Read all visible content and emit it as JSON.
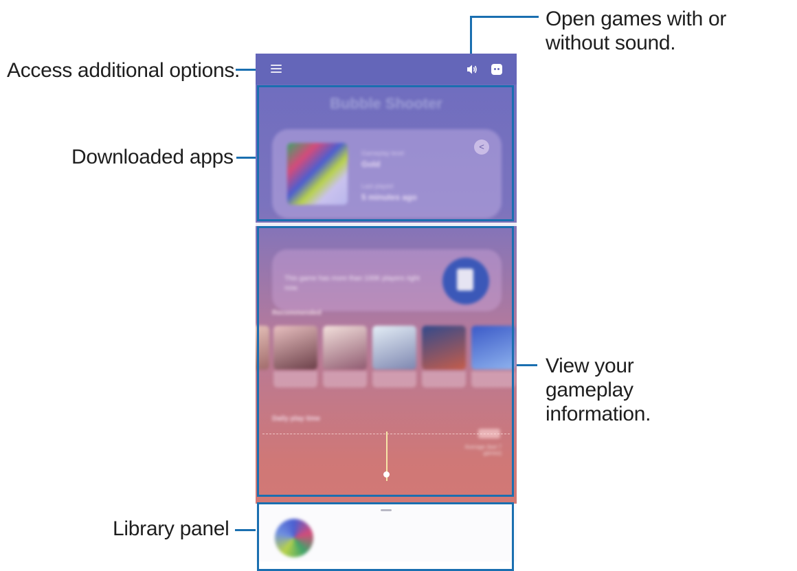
{
  "callouts": {
    "access_options": "Access additional options.",
    "open_games_sound": "Open games with or without sound.",
    "downloaded_apps": "Downloaded apps",
    "view_gameplay": "View your gameplay information.",
    "library_panel": "Library panel"
  },
  "colors": {
    "callout_line": "#1a6fb0",
    "topbar": "#6466b9"
  },
  "icons": [
    "menu-icon",
    "sound-icon",
    "discord-icon",
    "share-icon"
  ],
  "screen": {
    "game_title": "Bubble Shooter",
    "card": {
      "label1": "Gameplay level",
      "value1": "Gold",
      "label2": "Last played",
      "value2": "5 minutes ago"
    },
    "info_text": "This game has more than 100K players right now.",
    "recommended_label": "Recommended",
    "daily_play_time_label": "Daily play time",
    "average_label": "Average (last 7 games)"
  }
}
